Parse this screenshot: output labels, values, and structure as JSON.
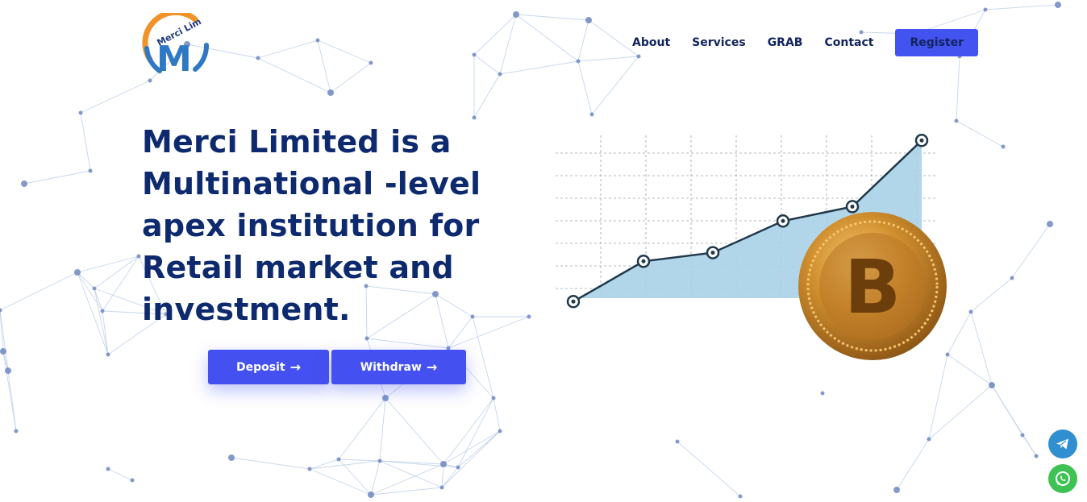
{
  "brand": {
    "logo_text": "Merci Lim",
    "logo_letter": "M"
  },
  "nav": {
    "items": [
      {
        "label": "About"
      },
      {
        "label": "Services"
      },
      {
        "label": "GRAB"
      },
      {
        "label": "Contact"
      }
    ],
    "register_label": "Register"
  },
  "hero": {
    "title_lines": [
      "Merci Limited is a",
      "Multinational -level",
      "apex institution for",
      "Retail market and",
      "investment."
    ],
    "deposit_label": "Deposit",
    "withdraw_label": "Withdraw",
    "arrow": "→"
  },
  "illustration": {
    "growth_points": [
      1,
      2.4,
      2.7,
      3.8,
      4.3,
      6.6
    ],
    "coin_symbol": "B"
  },
  "colors": {
    "primary": "#4353ef",
    "heading": "#0e2a6f",
    "telegram": "#2f8fd0",
    "whatsapp": "#3ec254",
    "chart_fill": "#a9d2e8",
    "coin_gold": "#c9892a"
  },
  "floating": {
    "telegram_icon": "telegram-icon",
    "whatsapp_icon": "whatsapp-icon"
  }
}
